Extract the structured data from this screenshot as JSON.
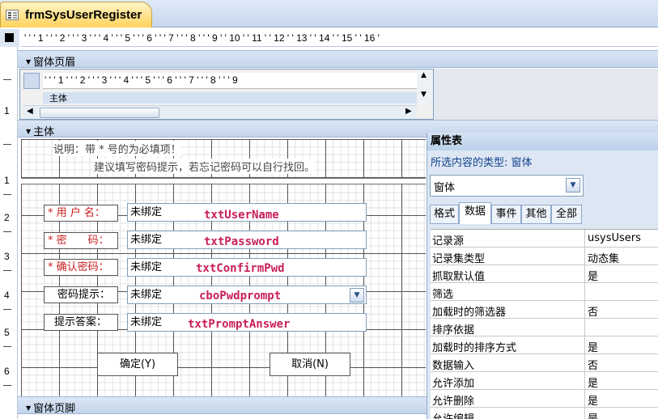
{
  "document_tab": {
    "title": "frmSysUserRegister",
    "icon": "form-icon"
  },
  "horizontal_ruler": {
    "marks": [
      "' ' ' 1 ' ' ' 2 ' ' ' 3 ' ' ' 4 ' ' ' 5 ' ' ' 6 ' ' ' 7 ' ' ' 8 ' ' ' 9 ' ' 10 ' ' 11 ' ' 12 ' ' 13 ' ' 14 ' ' 15 ' ' 16 '"
    ]
  },
  "vertical_ruler": {
    "marks": [
      "1",
      "1",
      "2",
      "3",
      "4",
      "5",
      "6"
    ]
  },
  "sections": {
    "form_header": "窗体页眉",
    "detail": "主体",
    "form_footer": "窗体页脚"
  },
  "subform": {
    "ruler": "' ' ' 1 ' ' ' 2 ' ' ' 3 ' ' ' 4 ' ' ' 5 ' ' ' 6 ' ' ' 7 ' ' ' 8 ' ' ' 9",
    "band_label": "主体"
  },
  "notes": {
    "line1": "说明：带 * 号的为必填项！",
    "line2": "建议填写密码提示，若忘记密码可以自行找回。"
  },
  "fields": [
    {
      "label": "* 用 户 名：",
      "required": true,
      "value": "未绑定",
      "control_name": "txtUserName"
    },
    {
      "label": "* 密　　码：",
      "required": true,
      "value": "未绑定",
      "control_name": "txtPassword"
    },
    {
      "label": "* 确认密码：",
      "required": true,
      "value": "未绑定",
      "control_name": "txtConfirmPwd"
    },
    {
      "label": "密码提示：",
      "required": false,
      "value": "未绑定",
      "control_name": "cboPwdprompt"
    },
    {
      "label": "提示答案：",
      "required": false,
      "value": "未绑定",
      "control_name": "txtPromptAnswer"
    }
  ],
  "buttons": {
    "ok": "确定(Y)",
    "cancel": "取消(N)"
  },
  "property_sheet": {
    "title": "属性表",
    "selection_type": "所选内容的类型: 窗体",
    "selected_object": "窗体",
    "tabs": [
      "格式",
      "数据",
      "事件",
      "其他",
      "全部"
    ],
    "active_tab": "数据",
    "rows": [
      {
        "key": "记录源",
        "value": "usysUsers"
      },
      {
        "key": "记录集类型",
        "value": "动态集"
      },
      {
        "key": "抓取默认值",
        "value": "是"
      },
      {
        "key": "筛选",
        "value": ""
      },
      {
        "key": "加载时的筛选器",
        "value": "否"
      },
      {
        "key": "排序依据",
        "value": ""
      },
      {
        "key": "加载时的排序方式",
        "value": "是"
      },
      {
        "key": "数据输入",
        "value": "否"
      },
      {
        "key": "允许添加",
        "value": "是"
      },
      {
        "key": "允许删除",
        "value": "是"
      },
      {
        "key": "允许编辑",
        "value": "是"
      }
    ]
  },
  "colors": {
    "required_label": "#c81e1e",
    "control_name": "#c81e5a",
    "tab_active": "#ffd25c"
  }
}
